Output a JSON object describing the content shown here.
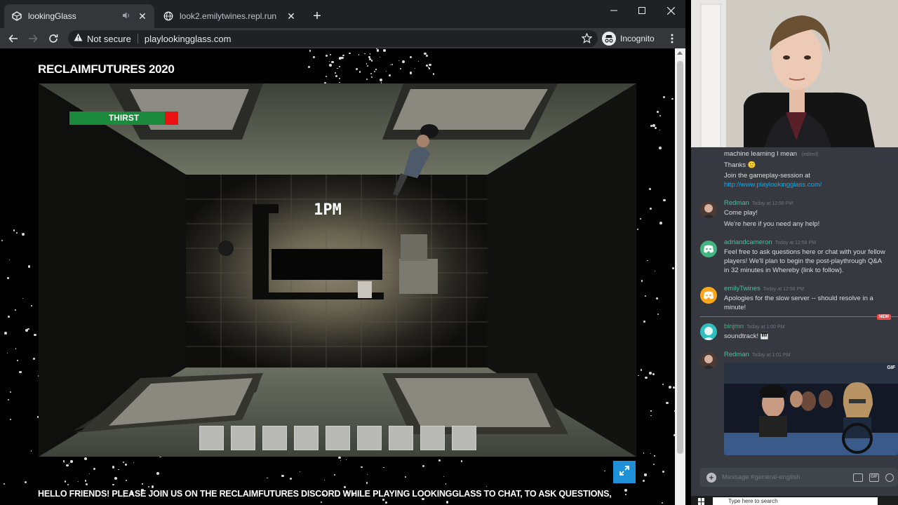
{
  "browser": {
    "tabs": [
      {
        "label": "lookingGlass",
        "active": true,
        "icon": "unity-icon",
        "audio": true
      },
      {
        "label": "look2.emilytwines.repl.run",
        "active": false,
        "icon": "globe-icon"
      }
    ],
    "security_label": "Not secure",
    "url": "playlookingglass.com",
    "profile_label": "Incognito"
  },
  "page": {
    "title": "RECLAIMFUTURES 2020",
    "banner": "HELLO FRIENDS! PLEASE JOIN US ON THE RECLAIMFUTURES DISCORD WHILE PLAYING LOOKINGGLASS TO CHAT, TO ASK QUESTIONS,"
  },
  "game": {
    "thirst_label": "THIRST",
    "thirst_level": 0.88,
    "clock": "1PM",
    "inventory_slot_count": 9,
    "accent_color": "#1e90d8"
  },
  "chat": {
    "messages": [
      {
        "lines": [
          "machine learning I mean"
        ],
        "edited": "(edited)"
      },
      {
        "lines": [
          "Thanks 🙂",
          "Join the gameplay-session at"
        ],
        "link": "http://www.playlookingglass.com/"
      },
      {
        "author": "Redman",
        "time": "Today at 12:56 PM",
        "lines": [
          "Come play!",
          "We're here if you need any help!"
        ]
      },
      {
        "author": "adriandcameron",
        "time": "Today at 12:58 PM",
        "lines": [
          "Feel free to ask questions here or chat with your fellow",
          "players! We'll plan to begin the post-playthrough Q&A",
          "in 32 minutes in Whereby (link to follow)."
        ]
      },
      {
        "author": "emilyTwines",
        "time": "Today at 12:58 PM",
        "lines": [
          "Apologies for the slow server -- should resolve in a",
          "minute!"
        ]
      },
      {
        "author": "binjmn",
        "time": "Today at 1:00 PM",
        "lines": [
          "soundtrack! 🎹"
        ]
      },
      {
        "author": "Redman",
        "time": "Today at 1:01 PM",
        "gif_badge": "GIF"
      }
    ],
    "new_tag": "NEW",
    "composer_placeholder": "Message #general-english"
  },
  "taskbar": {
    "search_placeholder": "Type here to search"
  }
}
